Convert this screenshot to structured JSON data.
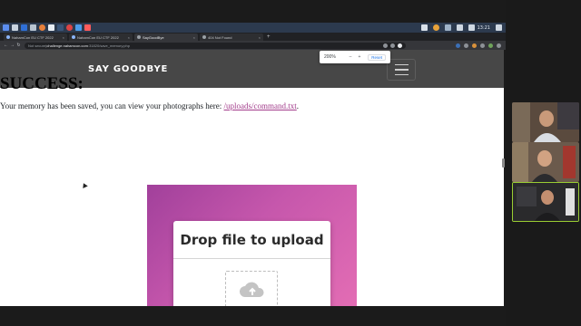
{
  "os": {
    "clock": "13:21"
  },
  "browser": {
    "tabs": [
      {
        "label": "NahamCon EU CTF 2022"
      },
      {
        "label": "NahamCon EU CTF 2022"
      },
      {
        "label": "SayGoodBye"
      },
      {
        "label": "404 Not Found"
      }
    ],
    "active_tab_index": 2,
    "new_tab_label": "+",
    "address": {
      "security": "Not secure",
      "separator": " | ",
      "host": "challenge.nahamcon.com",
      "path": ":31820/save_memory.php"
    },
    "zoom_popup": {
      "value": "200%",
      "minus_label": "–",
      "plus_label": "+",
      "reset_label": "Reset"
    }
  },
  "site": {
    "brand": "SAY GOODBYE",
    "success_heading": "SUCCESS:",
    "memory_message_prefix": "Your memory has been saved, you can view your photographs here: ",
    "memory_link_text": "/uploads/command.txt",
    "memory_message_suffix": ".",
    "upload": {
      "title": "Drop file to upload"
    }
  },
  "colors": {
    "nav_bg": "#474747",
    "link": "#a23b8a",
    "upload_gradient_start": "#a1409b",
    "upload_gradient_end": "#e36db4",
    "active_speaker_border": "#9acd32"
  },
  "participants": [
    {
      "speaking": false
    },
    {
      "speaking": false
    },
    {
      "speaking": true
    }
  ]
}
